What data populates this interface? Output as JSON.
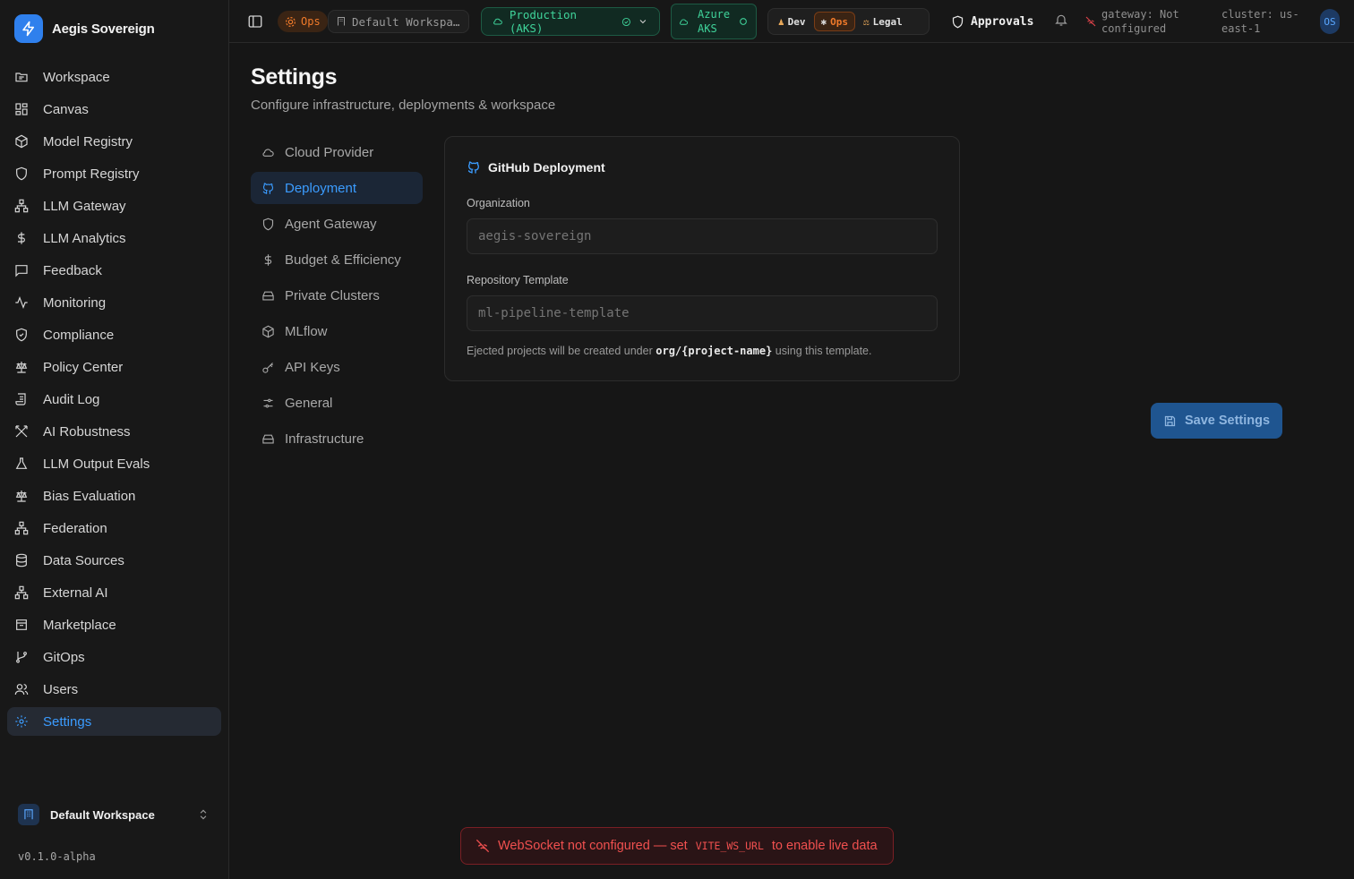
{
  "app": {
    "name": "Aegis Sovereign",
    "version": "v0.1.0-alpha",
    "accent": "#3b9cff"
  },
  "sidebar": {
    "items": [
      {
        "label": "Workspace",
        "icon": "folder-icon"
      },
      {
        "label": "Canvas",
        "icon": "grid-icon"
      },
      {
        "label": "Model Registry",
        "icon": "cube-icon"
      },
      {
        "label": "Prompt Registry",
        "icon": "shield-icon"
      },
      {
        "label": "LLM Gateway",
        "icon": "network-icon"
      },
      {
        "label": "LLM Analytics",
        "icon": "dollar-icon"
      },
      {
        "label": "Feedback",
        "icon": "message-icon"
      },
      {
        "label": "Monitoring",
        "icon": "activity-icon"
      },
      {
        "label": "Compliance",
        "icon": "shield-check-icon"
      },
      {
        "label": "Policy Center",
        "icon": "scale-icon"
      },
      {
        "label": "Audit Log",
        "icon": "scroll-icon"
      },
      {
        "label": "AI Robustness",
        "icon": "swords-icon"
      },
      {
        "label": "LLM Output Evals",
        "icon": "flask-icon"
      },
      {
        "label": "Bias Evaluation",
        "icon": "scale-icon"
      },
      {
        "label": "Federation",
        "icon": "network-icon"
      },
      {
        "label": "Data Sources",
        "icon": "database-icon"
      },
      {
        "label": "External AI",
        "icon": "network-icon"
      },
      {
        "label": "Marketplace",
        "icon": "store-icon"
      },
      {
        "label": "GitOps",
        "icon": "git-branch-icon"
      },
      {
        "label": "Users",
        "icon": "users-icon"
      },
      {
        "label": "Settings",
        "icon": "gear-icon",
        "active": true
      }
    ],
    "workspace_switcher": "Default Workspace"
  },
  "topbar": {
    "persona_chip": "Ops",
    "workspace_chip": "Default Workspa…",
    "environment": "Production (AKS)",
    "cloud_line1": "Azure",
    "cloud_line2": "AKS",
    "personas": [
      "Dev",
      "Ops",
      "Legal"
    ],
    "active_persona": "Ops",
    "approvals": "Approvals",
    "gateway_line1": "gateway: Not",
    "gateway_line2": "configured",
    "cluster_line1": "cluster: us-",
    "cluster_line2": "east-1",
    "avatar": "OS"
  },
  "page": {
    "title": "Settings",
    "subtitle": "Configure infrastructure, deployments & workspace"
  },
  "settings_nav": [
    {
      "label": "Cloud Provider",
      "icon": "cloud-icon"
    },
    {
      "label": "Deployment",
      "icon": "github-icon",
      "active": true
    },
    {
      "label": "Agent Gateway",
      "icon": "shield-icon"
    },
    {
      "label": "Budget & Efficiency",
      "icon": "dollar-icon"
    },
    {
      "label": "Private Clusters",
      "icon": "server-icon"
    },
    {
      "label": "MLflow",
      "icon": "cube-icon"
    },
    {
      "label": "API Keys",
      "icon": "key-icon"
    },
    {
      "label": "General",
      "icon": "sliders-icon"
    },
    {
      "label": "Infrastructure",
      "icon": "server-icon"
    }
  ],
  "deployment": {
    "title": "GitHub Deployment",
    "org_label": "Organization",
    "org_placeholder": "aegis-sovereign",
    "repo_label": "Repository Template",
    "repo_placeholder": "ml-pipeline-template",
    "hint_prefix": "Ejected projects will be created under",
    "hint_code": "org/{project-name}",
    "hint_suffix": "using this template."
  },
  "save_label": "Save Settings",
  "toast": {
    "prefix": "WebSocket not configured — set",
    "code": "VITE_WS_URL",
    "suffix": "to enable live data"
  }
}
